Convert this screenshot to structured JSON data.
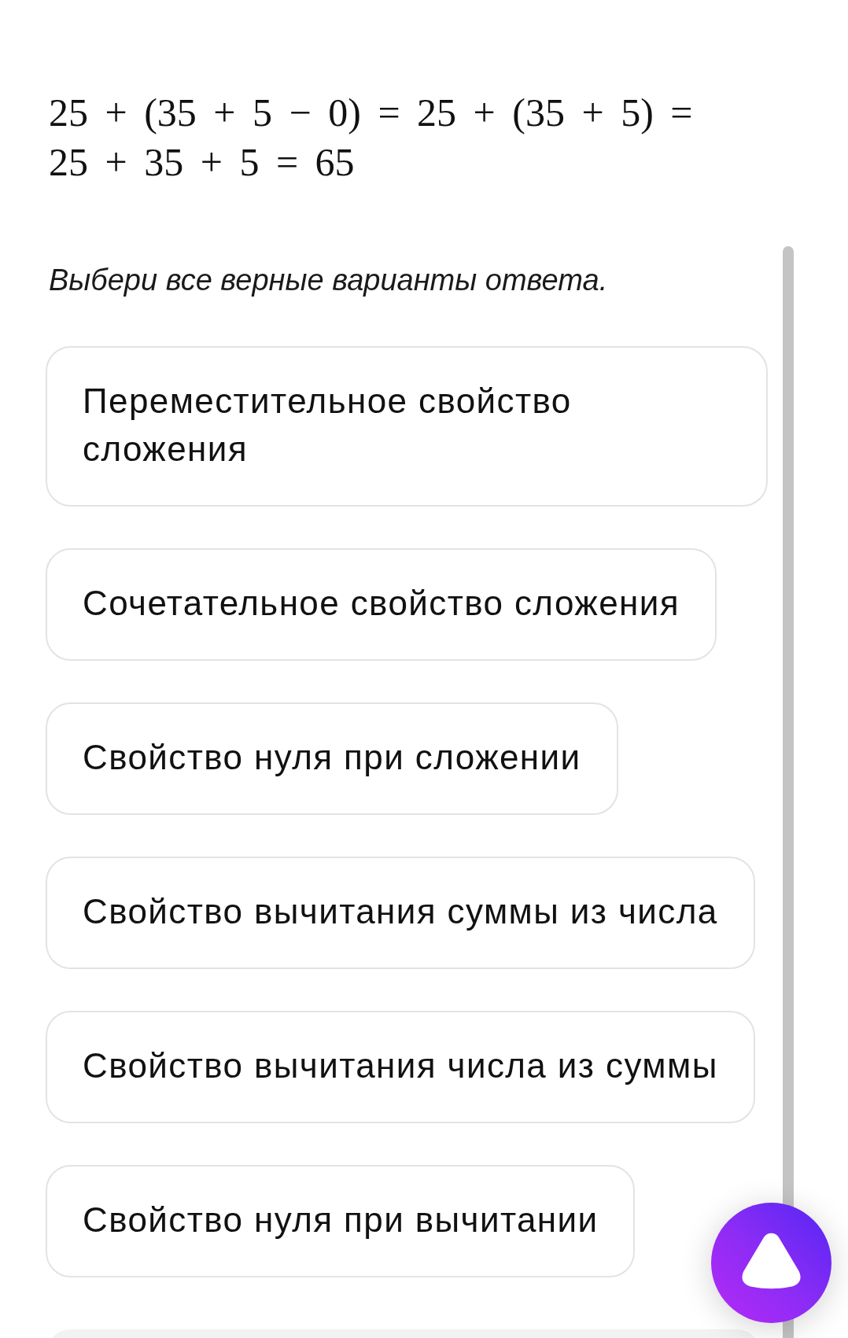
{
  "expression": {
    "lines": [
      "25 + (35 + 5 − 0) = 25 + (35 + 5) =",
      "25 + 35 + 5 = 65"
    ]
  },
  "instruction": "Выбери все верные варианты ответа.",
  "options": [
    {
      "label": "Переместительное свойство сложения",
      "selected": false
    },
    {
      "label": "Сочетательное свойство сложения",
      "selected": false
    },
    {
      "label": "Свойство нуля при сложении",
      "selected": false
    },
    {
      "label": "Свойство вычитания суммы из числа",
      "selected": false
    },
    {
      "label": "Свойство вычитания числа из суммы",
      "selected": false
    },
    {
      "label": "Свойство нуля при вычитании",
      "selected": false
    }
  ]
}
